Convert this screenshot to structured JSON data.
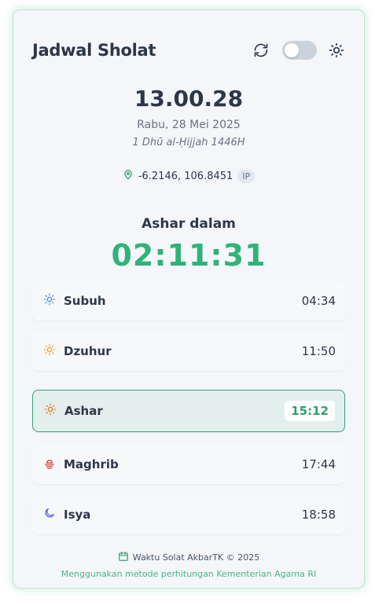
{
  "header": {
    "title": "Jadwal Sholat"
  },
  "clock": "13.00.28",
  "date": {
    "gregorian": "Rabu, 28 Mei 2025",
    "hijri": "1 Dhū al-Ḥijjah 1446H"
  },
  "location": {
    "coords": "-6.2146, 106.8451",
    "source_badge": "IP"
  },
  "next_prayer": {
    "label": "Ashar dalam",
    "countdown": "02:11:31"
  },
  "prayers": [
    {
      "name": "Subuh",
      "time": "04:34",
      "icon": "sunrise-icon",
      "color": "#4a90d9",
      "active": false
    },
    {
      "name": "Dzuhur",
      "time": "11:50",
      "icon": "sun-icon",
      "color": "#e8a91c",
      "active": false
    },
    {
      "name": "Ashar",
      "time": "15:12",
      "icon": "sun-afternoon-icon",
      "color": "#e07b2b",
      "active": true
    },
    {
      "name": "Maghrib",
      "time": "17:44",
      "icon": "sunset-icon",
      "color": "#e04545",
      "active": false
    },
    {
      "name": "Isya",
      "time": "18:58",
      "icon": "moon-icon",
      "color": "#5a67d8",
      "active": false
    }
  ],
  "footer": {
    "credit": "Waktu Solat AkbarTK © 2025",
    "note": "Menggunakan metode perhitungan Kementerian Agama RI"
  },
  "theme": {
    "dark_mode": false,
    "accent": "#2fb37a"
  }
}
